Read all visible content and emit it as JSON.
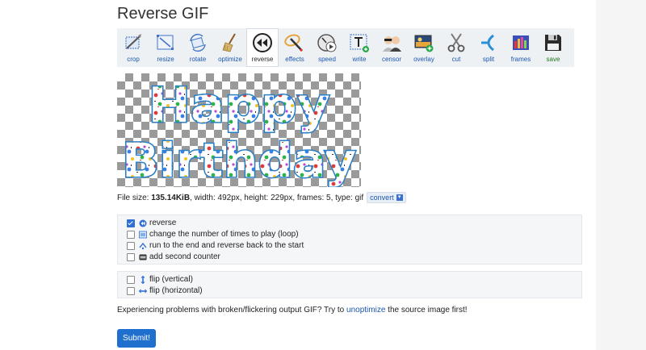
{
  "page": {
    "title": "Reverse GIF"
  },
  "toolbar": {
    "tools": [
      {
        "label": "crop",
        "icon": "crop-icon"
      },
      {
        "label": "resize",
        "icon": "resize-icon"
      },
      {
        "label": "rotate",
        "icon": "rotate-icon"
      },
      {
        "label": "optimize",
        "icon": "broom-icon"
      },
      {
        "label": "reverse",
        "icon": "rewind-icon",
        "active": true
      },
      {
        "label": "effects",
        "icon": "magic-wand-icon"
      },
      {
        "label": "speed",
        "icon": "speed-icon"
      },
      {
        "label": "write",
        "icon": "text-icon"
      },
      {
        "label": "censor",
        "icon": "censor-icon"
      },
      {
        "label": "overlay",
        "icon": "overlay-icon"
      },
      {
        "label": "cut",
        "icon": "scissors-icon"
      },
      {
        "label": "split",
        "icon": "split-icon"
      },
      {
        "label": "frames",
        "icon": "frames-icon"
      },
      {
        "label": "save",
        "icon": "floppy-disk-icon"
      }
    ]
  },
  "image": {
    "line1": "Happy",
    "line2": "Birthday"
  },
  "file_info": {
    "prefix": "File size: ",
    "size": "135.14KiB",
    "details": ", width: 492px, height: 229px, frames: 5, type: gif",
    "convert_label": "convert"
  },
  "options": {
    "reverse": {
      "label": "reverse",
      "checked": true
    },
    "loop": {
      "label": "change the number of times to play (loop)",
      "checked": false
    },
    "bounce": {
      "label": "run to the end and reverse back to the start",
      "checked": false
    },
    "counter": {
      "label": "add second counter",
      "checked": false
    },
    "flip_v": {
      "label": "flip (vertical)",
      "checked": false
    },
    "flip_h": {
      "label": "flip (horizontal)",
      "checked": false
    }
  },
  "problems": {
    "prefix": "Experiencing problems with broken/flickering output GIF? Try to ",
    "link": "unoptimize",
    "suffix": " the source image first!"
  },
  "submit": {
    "label": "Submit!"
  },
  "colors": {
    "accent": "#1f6fcf",
    "link": "#1a56b0",
    "save_label": "#1a7a1a"
  }
}
